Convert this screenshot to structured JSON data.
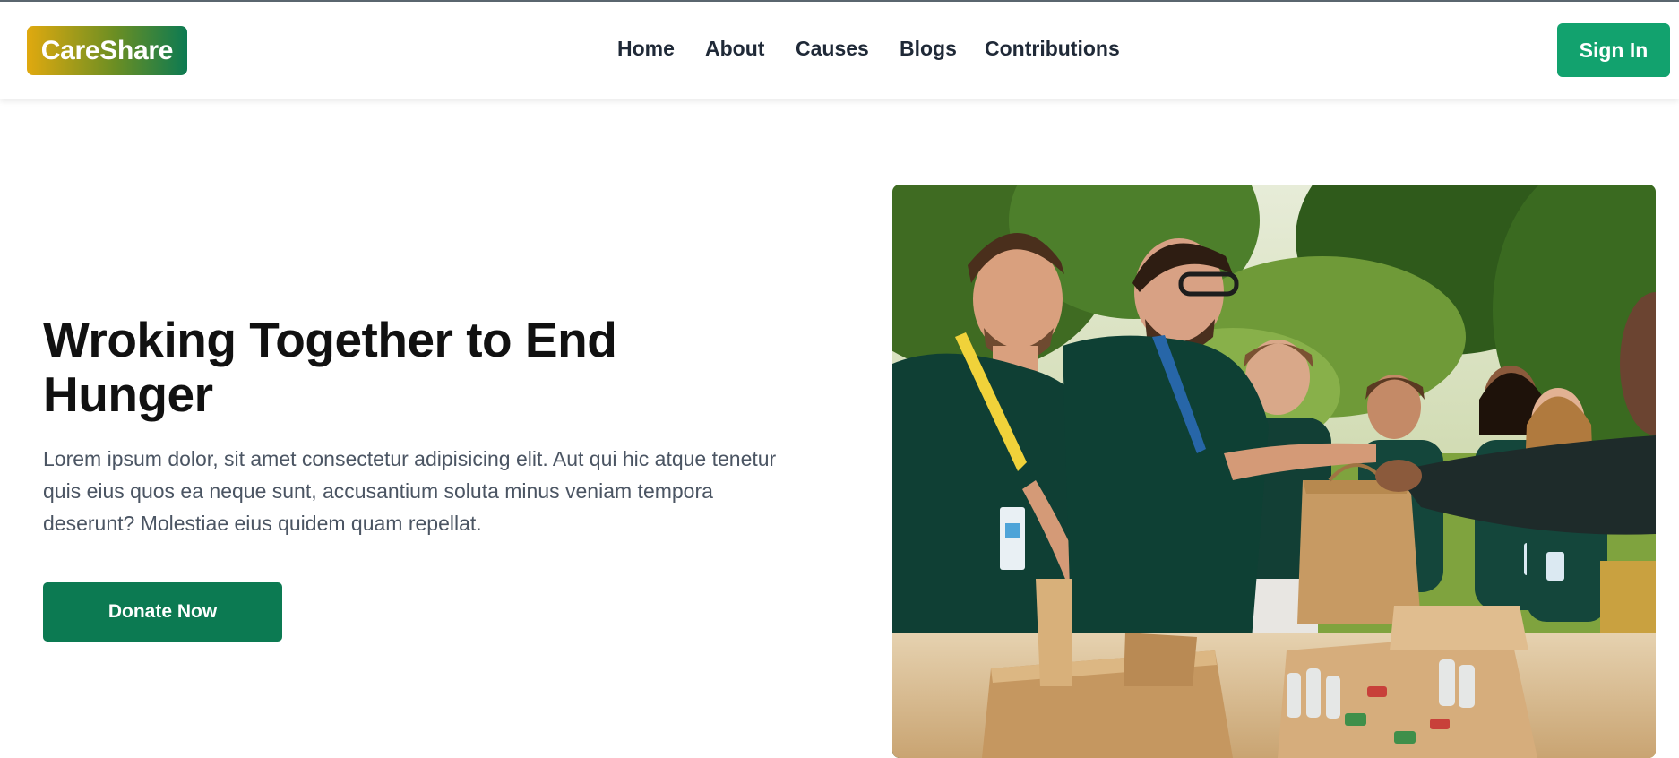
{
  "header": {
    "logo_text": "CareShare",
    "nav": [
      "Home",
      "About",
      "Causes",
      "Blogs",
      "Contributions"
    ],
    "signin_label": "Sign In"
  },
  "hero": {
    "title": "Wroking Together to End Hunger",
    "text": "Lorem ipsum dolor, sit amet consectetur adipisicing elit. Aut qui hic atque tenetur quis eius quos ea neque sunt, accusantium soluta minus veniam tempora deserunt? Molestiae eius quidem quam repellat.",
    "donate_label": "Donate Now",
    "photo_subject": "volunteers-food-distribution"
  },
  "colors": {
    "primary": "#0c7a52",
    "signin": "#12a26e",
    "logo_gradient": [
      "#e0a90f",
      "#0c7a52"
    ],
    "text_dark": "#111111",
    "text_muted": "#4b5563"
  }
}
